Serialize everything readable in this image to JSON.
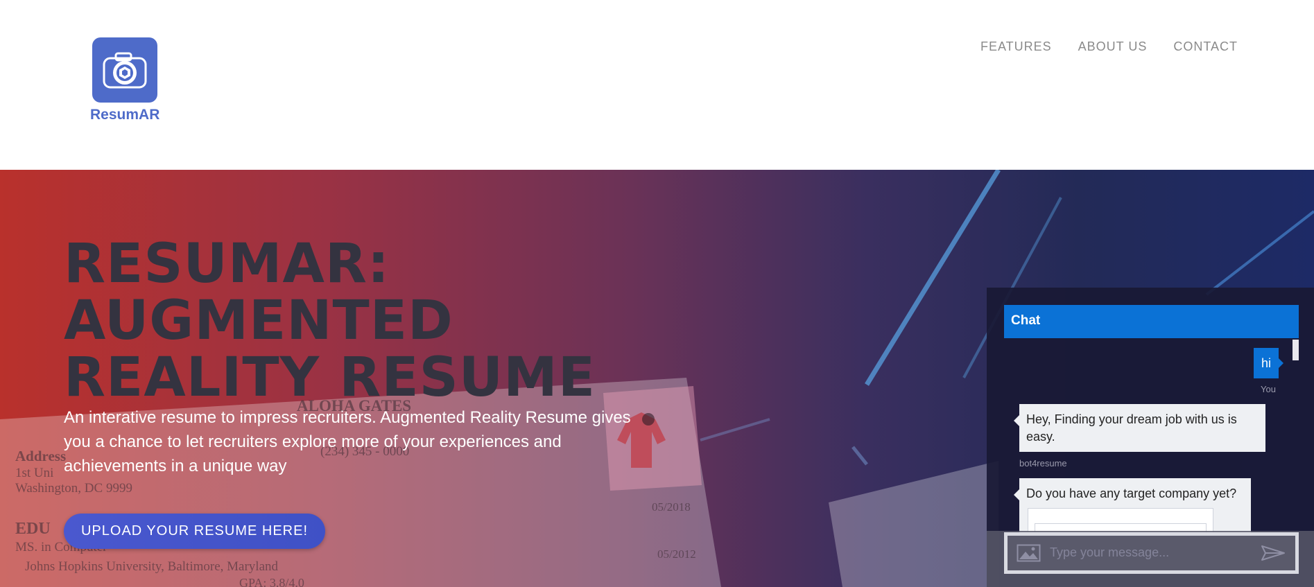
{
  "brand": {
    "name": "ResumAR",
    "logo_icon": "camera-aperture-icon",
    "color": "#4e6bc9"
  },
  "nav": {
    "items": [
      "FEATURES",
      "ABOUT US",
      "CONTACT"
    ]
  },
  "hero": {
    "title": "RESUMAR:\nAUGMENTED\nREALITY RESUME",
    "subtitle": "An interative resume to impress recruiters. Augmented Reality Resume gives you a chance to let recruiters explore more of your experiences and achievements in a unique way",
    "cta_label": "UPLOAD YOUR RESUME HERE!",
    "background_photo": {
      "name": "ALOHA GATES",
      "phone": "(234) 345 - 0000",
      "address_heading": "Address",
      "address_line1": "1st Uni",
      "address_line2": "Washington, DC 9999",
      "education_heading": "EDU",
      "degree": "MS. in Computer",
      "school": "Johns Hopkins University, Baltimore, Maryland",
      "gpa": "GPA: 3.8/4.0",
      "date1": "05/2018",
      "date2": "05/2012"
    }
  },
  "chat": {
    "header": "Chat",
    "user_message": "hi",
    "user_label": "You",
    "bot_message_1": "Hey, Finding your dream job with us is easy.",
    "bot_name": "bot4resume",
    "bot_message_2": "Do you have any target company yet?",
    "input_placeholder": "Type your message...",
    "accent_color": "#0b72d6"
  }
}
